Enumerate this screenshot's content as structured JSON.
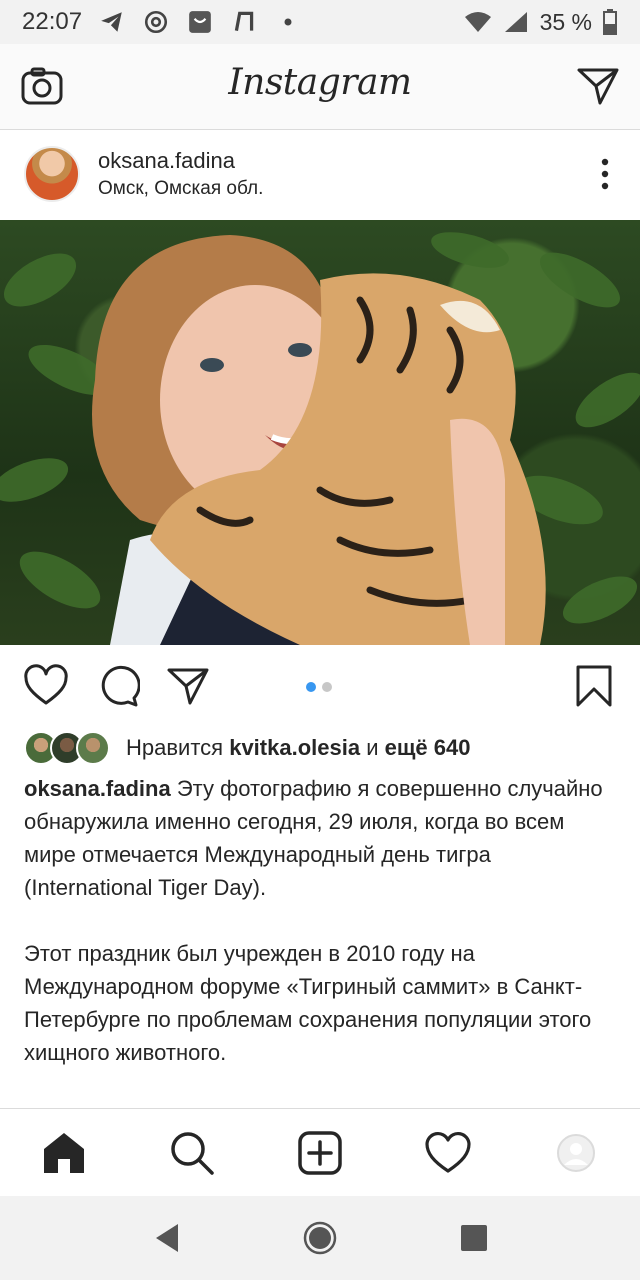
{
  "status_bar": {
    "time": "22:07",
    "battery": "35 %",
    "notification_icons": [
      "telegram-icon",
      "at-icon",
      "mail-icon",
      "app-icon",
      "dot-icon"
    ],
    "system_icons": [
      "wifi-icon",
      "signal-icon",
      "battery-icon"
    ]
  },
  "app_bar": {
    "logo": "Instagram",
    "left_icon": "camera-icon",
    "right_icon": "direct-message-icon"
  },
  "post": {
    "username": "oksana.fadina",
    "location": "Омск, Омская обл.",
    "carousel": {
      "count": 2,
      "active_index": 0
    },
    "likes": {
      "prefix": "Нравится ",
      "liker": "kvitka.olesia",
      "connector": " и ",
      "more": "ещё 640"
    },
    "caption": {
      "username": "oksana.fadina",
      "paragraph1": "Эту фотографию я совершенно случайно обнаружила именно сегодня, 29 июля, когда во всем мире отмечается Международный день тигра (International Tiger Day).",
      "paragraph2": "Этот праздник был учрежден в 2010 году на Международном форуме «Тигриный саммит» в Санкт-Петербурге по проблемам сохранения популяции этого хищного животного."
    }
  },
  "colors": {
    "accent": "#3897f0",
    "text": "#262626",
    "divider": "#dbdbdb"
  }
}
